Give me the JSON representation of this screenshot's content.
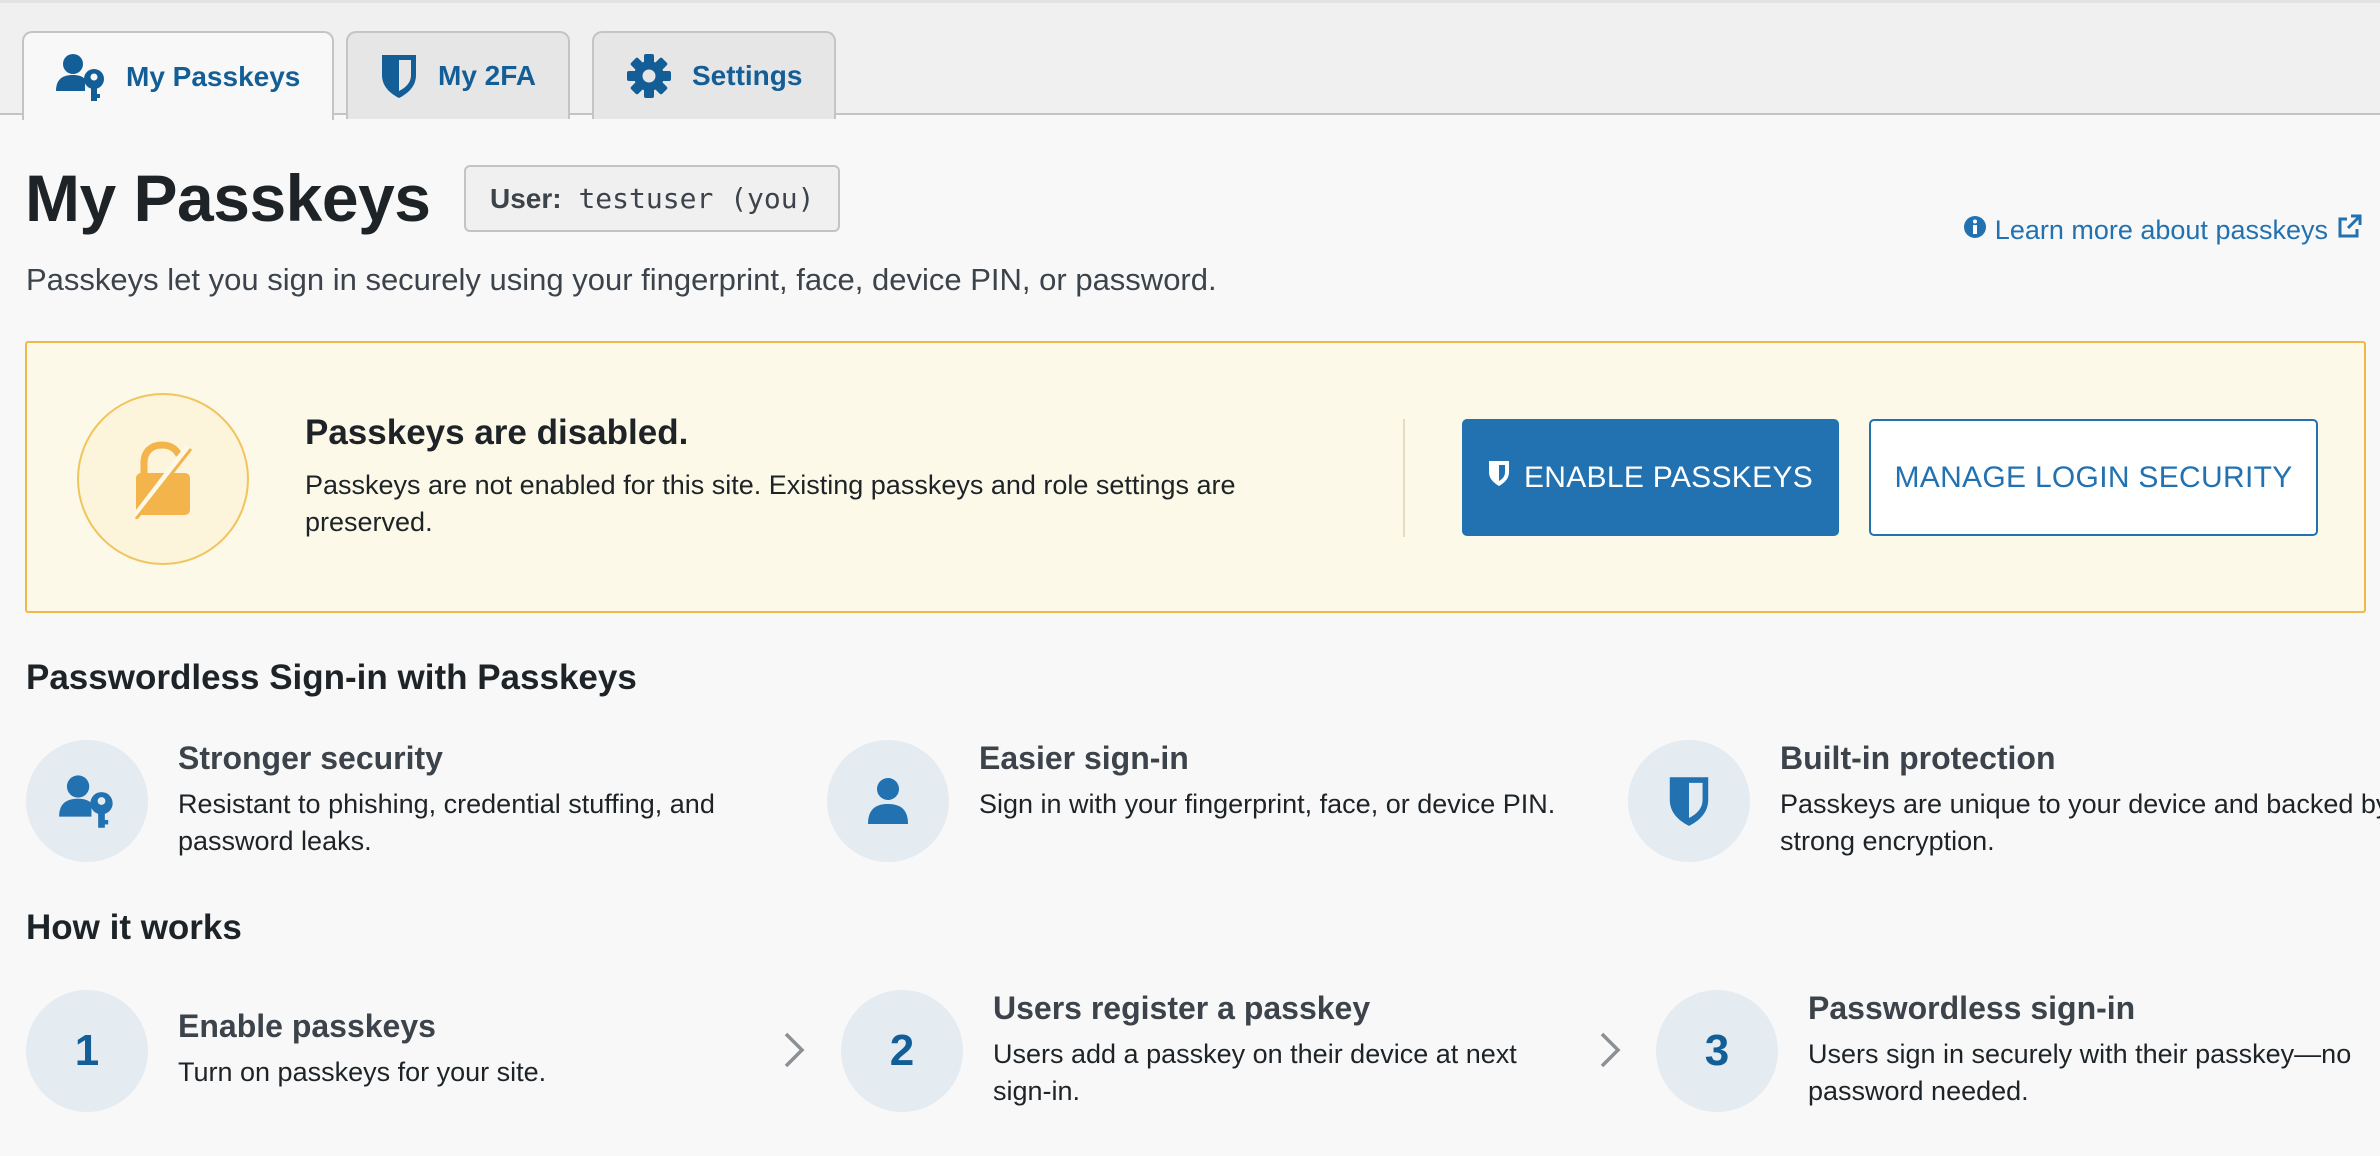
{
  "tabs": [
    {
      "label": "My Passkeys",
      "icon": "user-key-icon",
      "active": true
    },
    {
      "label": "My 2FA",
      "icon": "shield-icon",
      "active": false
    },
    {
      "label": "Settings",
      "icon": "gear-icon",
      "active": false
    }
  ],
  "header": {
    "title": "My Passkeys",
    "user_label": "User:",
    "user_value": "testuser (you)",
    "learn_more": "Learn more about passkeys",
    "subtitle": "Passkeys let you sign in securely using your fingerprint, face, device PIN, or password."
  },
  "notice": {
    "title": "Passkeys are disabled.",
    "text": "Passkeys are not enabled for this site. Existing passkeys and role settings are preserved.",
    "enable_button": "ENABLE PASSKEYS",
    "manage_button": "MANAGE LOGIN SECURITY",
    "icon": "lock-disabled-icon"
  },
  "features": {
    "title": "Passwordless Sign-in with Passkeys",
    "items": [
      {
        "title": "Stronger security",
        "desc": "Resistant to phishing, credential stuffing, and password leaks.",
        "icon": "user-key-icon"
      },
      {
        "title": "Easier sign-in",
        "desc": "Sign in with your fingerprint, face, or device PIN.",
        "icon": "user-icon"
      },
      {
        "title": "Built-in protection",
        "desc": "Passkeys are unique to your device and backed by strong encryption.",
        "icon": "shield-icon"
      }
    ]
  },
  "how": {
    "title": "How it works",
    "steps": [
      {
        "num": "1",
        "title": "Enable passkeys",
        "desc": "Turn on passkeys for your site."
      },
      {
        "num": "2",
        "title": "Users register a passkey",
        "desc": "Users add a passkey on their device at next sign-in."
      },
      {
        "num": "3",
        "title": "Passwordless sign-in",
        "desc": "Users sign in securely with their passkey—no password needed."
      }
    ]
  },
  "colors": {
    "accent": "#2271b1",
    "accent_dark": "#135e96",
    "warning_border": "#f0b849",
    "warning_bg": "#fcf9e8",
    "lock": "#f2b44b",
    "icon_circle": "#e4ebf1"
  }
}
